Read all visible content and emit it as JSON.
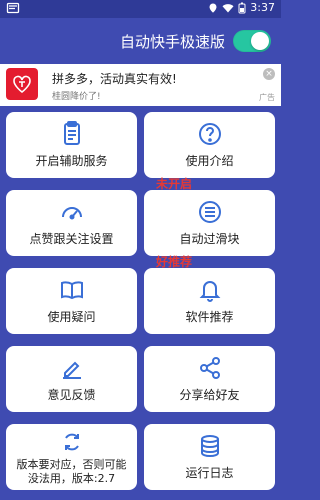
{
  "statusbar": {
    "time": "3:37"
  },
  "topbar": {
    "title": "自动快手极速版",
    "toggle_on": true
  },
  "ad": {
    "title": "拼多多，活动真实有效!",
    "subtitle": "桂圆降价了!",
    "close_label": "×",
    "ad_tag": "广告"
  },
  "grid": {
    "cards": [
      {
        "label": "开启辅助服务",
        "icon": "clipboard-icon",
        "badge": ""
      },
      {
        "label": "使用介绍",
        "icon": "question-icon",
        "badge": ""
      },
      {
        "label": "点赞跟关注设置",
        "icon": "speedometer-icon",
        "badge": ""
      },
      {
        "label": "自动过滑块",
        "icon": "list-icon",
        "badge": "未开启"
      },
      {
        "label": "使用疑问",
        "icon": "book-icon",
        "badge": ""
      },
      {
        "label": "软件推荐",
        "icon": "bell-icon",
        "badge": "好推荐"
      },
      {
        "label": "意见反馈",
        "icon": "pen-icon",
        "badge": ""
      },
      {
        "label": "分享给好友",
        "icon": "share-icon",
        "badge": ""
      },
      {
        "label": "版本要对应，否则可能没法用，版本:2.7",
        "label_line1": "版本要对应，否则可能",
        "label_line2": "没法用，版本:2.7",
        "icon": "refresh-icon",
        "badge": ""
      },
      {
        "label": "运行日志",
        "icon": "database-icon",
        "badge": ""
      }
    ]
  },
  "colors": {
    "primary": "#3f4bb1",
    "status": "#2f3a97",
    "toggle": "#26c6a1",
    "icon": "#3a6fd6",
    "badge": "#e53935",
    "ad_logo": "#e41c2f"
  }
}
